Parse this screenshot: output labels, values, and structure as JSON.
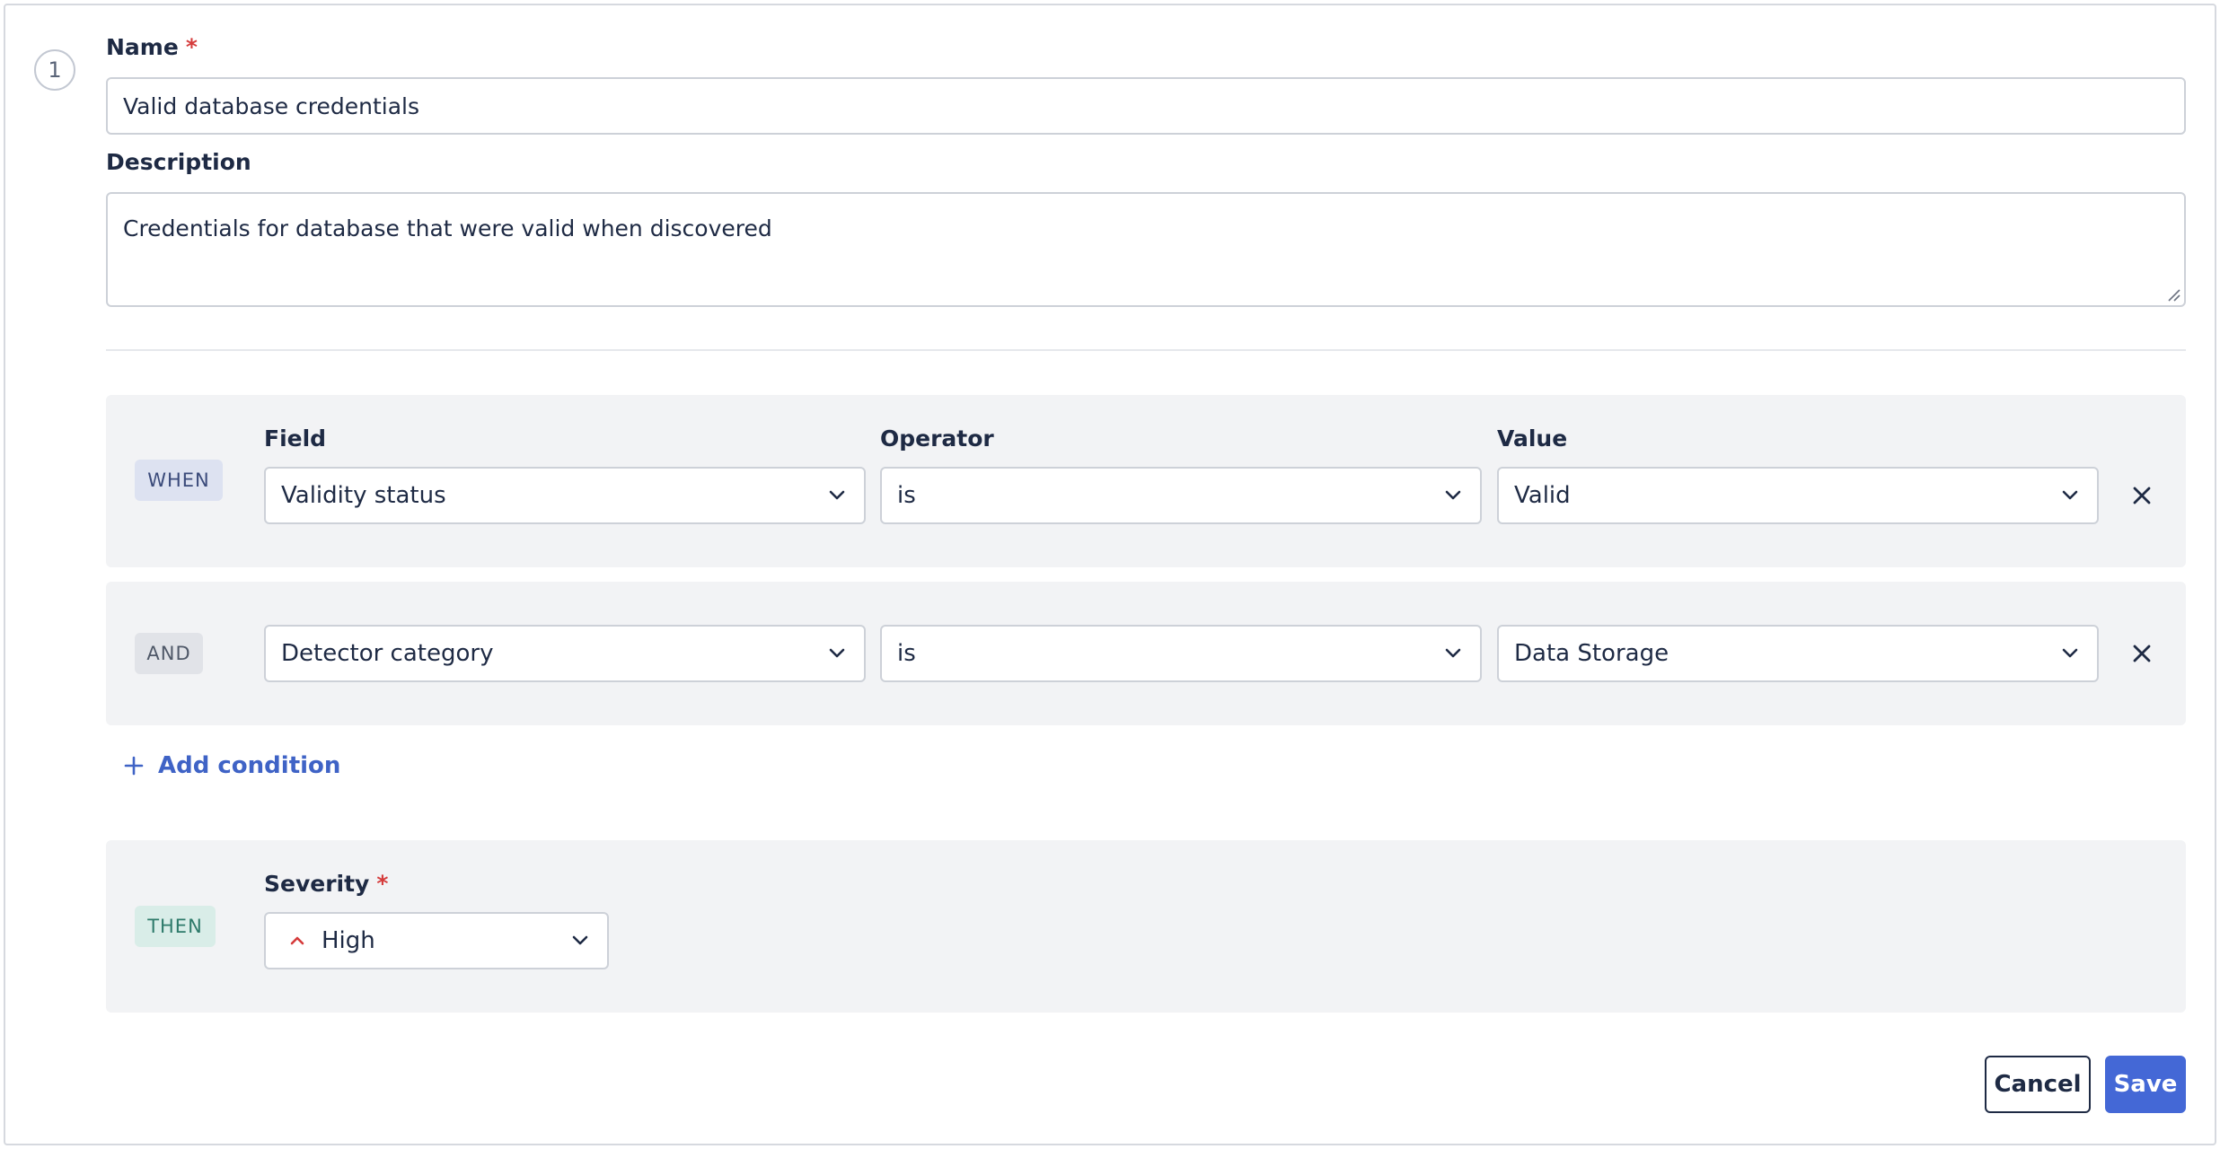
{
  "step": {
    "number": "1"
  },
  "name": {
    "label": "Name",
    "required_mark": "*",
    "value": "Valid database credentials"
  },
  "description": {
    "label": "Description",
    "value": "Credentials for database that were valid when discovered"
  },
  "conditions": {
    "headers": {
      "field": "Field",
      "operator": "Operator",
      "value": "Value"
    },
    "rows": [
      {
        "connector": "WHEN",
        "field": "Validity status",
        "operator": "is",
        "value": "Valid"
      },
      {
        "connector": "AND",
        "field": "Detector category",
        "operator": "is",
        "value": "Data Storage"
      }
    ],
    "add_label": "Add condition"
  },
  "action": {
    "connector": "THEN",
    "severity_label": "Severity",
    "required_mark": "*",
    "severity_value": "High",
    "severity_icon": "chevron-up-icon",
    "severity_color": "#d53b3b"
  },
  "buttons": {
    "cancel": "Cancel",
    "save": "Save"
  },
  "colors": {
    "accent": "#4468d6",
    "link": "#3f63c6",
    "required": "#d53b3b"
  }
}
